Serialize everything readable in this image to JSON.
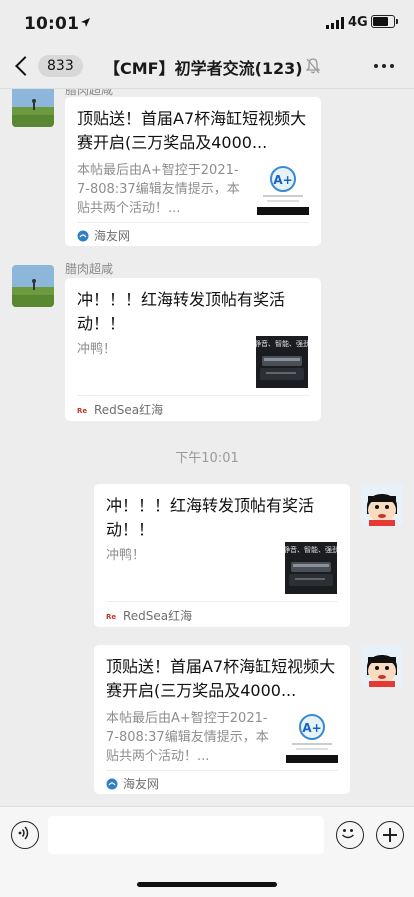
{
  "status_bar": {
    "time": "10:01",
    "network": "4G",
    "battery_level": 0.85
  },
  "nav": {
    "unread_count": "833",
    "title": "【CMF】初学者交流(123)"
  },
  "messages": [
    {
      "side": "left",
      "sender": "腊肉超咸",
      "title": "顶贴送！首届A7杯海缸短视频大赛开启(三万奖品及4000...",
      "desc": "本帖最后由A+智控于2021-7-808:37编辑友情提示，本贴共两个活动！...",
      "source": "海友网"
    },
    {
      "side": "left",
      "sender": "腊肉超咸",
      "title": "冲！！！红海转发顶帖有奖活动！！",
      "desc": "冲鸭！",
      "source": "RedSea红海"
    },
    {
      "side": "right",
      "title": "冲！！！红海转发顶帖有奖活动！！",
      "desc": "冲鸭！",
      "source": "RedSea红海"
    },
    {
      "side": "right",
      "title": "顶贴送！首届A7杯海缸短视频大赛开启(三万奖品及4000...",
      "desc": "本帖最后由A+智控于2021-7-808:37编辑友情提示，本贴共两个活动！...",
      "source": "海友网"
    }
  ],
  "time_separator": "下午10:01",
  "thumb_text": {
    "redsea_line1": "静音、智能、强劲",
    "logo_small": "RedSea"
  },
  "input": {
    "placeholder": ""
  },
  "colors": {
    "bg": "#ededed",
    "card": "#ffffff",
    "muted": "#8e8e8e"
  }
}
